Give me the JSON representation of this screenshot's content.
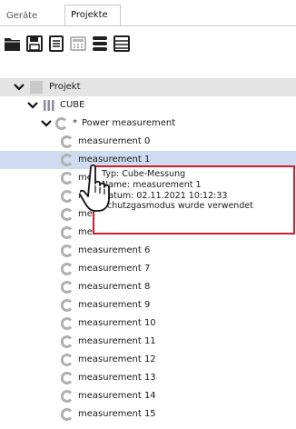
{
  "tabs": [
    {
      "label": "Geräte",
      "active": false
    },
    {
      "label": "Projekte",
      "active": true
    }
  ],
  "toolbar": {
    "buttons": [
      {
        "icon": "open-folder-icon"
      },
      {
        "icon": "save-icon"
      },
      {
        "icon": "document-list-icon"
      },
      {
        "icon": "calculator-icon"
      },
      {
        "icon": "database-icon"
      },
      {
        "icon": "list-icon"
      }
    ]
  },
  "tree": {
    "root": {
      "label": "Projekt",
      "expanded": true
    },
    "cube": {
      "label": "CUBE",
      "expanded": true
    },
    "group": {
      "marker": "*",
      "label": "Power measurement",
      "expanded": true
    },
    "items": [
      "measurement 0",
      "measurement 1",
      "measurement 2",
      "measurement 3",
      "measurement 4",
      "measurement 5",
      "measurement 6",
      "measurement 7",
      "measurement 8",
      "measurement 9",
      "measurement 10",
      "measurement 11",
      "measurement 12",
      "measurement 13",
      "measurement 14",
      "measurement 15"
    ],
    "selected_index": 1
  },
  "tooltip": {
    "lines": [
      "Typ: Cube-Messung",
      "Name: measurement 1",
      "Datum: 02.11.2021 10:12:33",
      "Schutzgasmodus wurde verwendet"
    ]
  },
  "colors": {
    "selection": "#cfdcef",
    "tooltip_border": "#d01f2b",
    "icon_dark": "#1f1f1f"
  }
}
